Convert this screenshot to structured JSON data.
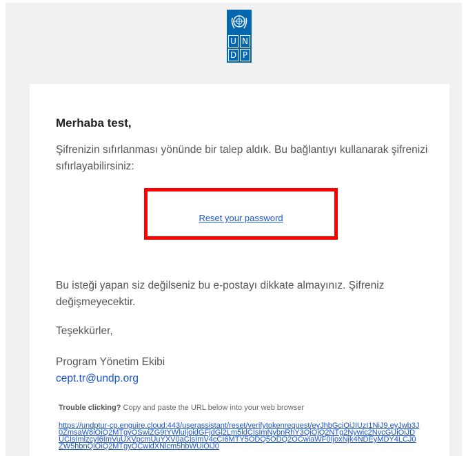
{
  "logo": {
    "letters": [
      "U",
      "N",
      "D",
      "P"
    ],
    "brand_color": "#0468b1",
    "icon": "un-emblem-icon"
  },
  "email": {
    "greeting": "Merhaba test,",
    "intro": "Şifrenizin sıfırlanması yönünde bir talep aldık. Bu bağlantıyı kullanarak şifrenizi sıfırlayabilirsiniz:",
    "reset_link": "Reset your password",
    "ignore_note": "Bu isteği yapan siz değilseniz bu e-postayı dikkate almayınız. Şifreniz değişmeyecektir.",
    "thanks": "Teşekkürler,",
    "signature": "Program Yönetim Ekibi",
    "contact_email": "cept.tr@undp.org",
    "trouble_bold": "Trouble clicking?",
    "trouble_text": " Copy and paste the URL below into your web browser",
    "long_url": "https://undptur-cp.enguire.cloud:443/userassistant/reset/verifytokenrequest/eyJhbGciOiJIUzI1NiJ9.eyJwb3J0ZmsaW8iOiQ2MTgyOSwiZG9tYWluIjoidGFjdGl2Lm5ldCIsImNybnRhY3QiOjQ2NTg2Nywic2NvcGUiOiJDUCIsImlzcyI6ImVuUXVpcmUuYXV0aCIsImV4cCI6MTY5ODQ5ODQ2OCwiaWF0IjoxNjk4NDEyMDY4LCJ0ZW5hbnQiOiQ2MTgyOCwidXNlcm5hbWUiOiJ0"
  },
  "colors": {
    "highlight": "#ff0000",
    "link": "#1a55cc",
    "background": "#f1f1f1"
  }
}
